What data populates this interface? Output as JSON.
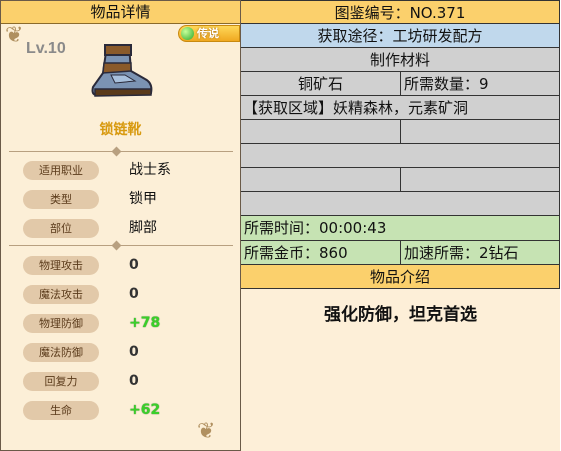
{
  "left_panel": {
    "header": "物品详情",
    "level": "Lv.10",
    "rarity_badge": "传说",
    "item_name": "锁链靴",
    "info": [
      {
        "label": "适用职业",
        "value": "战士系"
      },
      {
        "label": "类型",
        "value": "锁甲"
      },
      {
        "label": "部位",
        "value": "脚部"
      }
    ],
    "stats": [
      {
        "label": "物理攻击",
        "value": "0"
      },
      {
        "label": "魔法攻击",
        "value": "0"
      },
      {
        "label": "物理防御",
        "value": "+78"
      },
      {
        "label": "魔法防御",
        "value": "0"
      },
      {
        "label": "回复力",
        "value": "0"
      },
      {
        "label": "生命",
        "value": "+62"
      }
    ]
  },
  "right_panel": {
    "codex_number": "图鉴编号：NO.371",
    "source": "获取途径：工坊研发配方",
    "materials_header": "制作材料",
    "material_name": "铜矿石",
    "material_qty": "所需数量：9",
    "region": "【获取区域】妖精森林，元素矿洞",
    "time": "所需时间：00:00:43",
    "gold": "所需金币：860",
    "speedup": "加速所需：2钻石",
    "intro_header": "物品介绍",
    "intro_text": "强化防御，坦克首选"
  },
  "colors": {
    "header_yellow": "#fbd06c",
    "row_blue": "#c0d8ec",
    "row_gray": "#d0d0d0",
    "row_green": "#c6e3b3",
    "stat_plus_green": "#3ad02a",
    "item_name_gold": "#d89a10"
  }
}
